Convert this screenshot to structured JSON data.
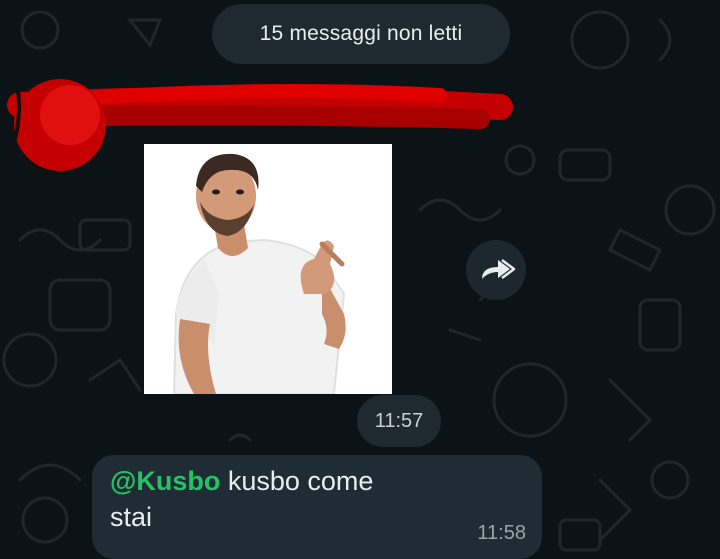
{
  "chat": {
    "unread_banner": "15 messaggi non letti",
    "sticker": {
      "description_icon": "man-pointing-thumb-sticker",
      "time": "11:57"
    },
    "forward_icon": "forward-arrow-icon",
    "message": {
      "mention": "@Kusbo",
      "text": " kusbo come stai",
      "time": "11:58"
    }
  },
  "colors": {
    "background": "#0c1317",
    "bubble": "#1f2c33",
    "pill": "#1f2a30",
    "mention": "#25c266",
    "text": "#e9edef",
    "redaction": "#d00000"
  }
}
